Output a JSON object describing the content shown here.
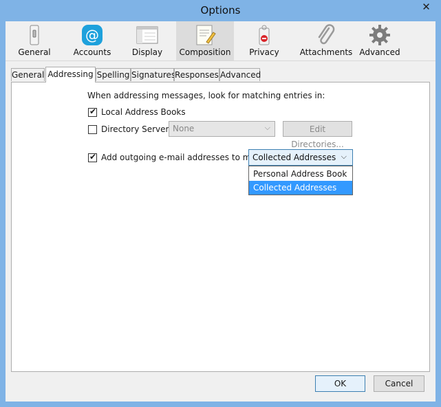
{
  "window": {
    "title": "Options",
    "close_glyph": "✕"
  },
  "toolbar": {
    "items": [
      {
        "label": "General",
        "icon": "general-switch-icon"
      },
      {
        "label": "Accounts",
        "icon": "at-sign-icon"
      },
      {
        "label": "Display",
        "icon": "display-window-icon"
      },
      {
        "label": "Composition",
        "icon": "composition-notepad-icon",
        "selected": true
      },
      {
        "label": "Privacy",
        "icon": "privacy-tag-icon"
      },
      {
        "label": "Attachments",
        "icon": "paperclip-icon"
      },
      {
        "label": "Advanced",
        "icon": "gear-icon"
      }
    ]
  },
  "subtabs": [
    "General",
    "Addressing",
    "Spelling",
    "Signatures",
    "Responses",
    "Advanced"
  ],
  "active_subtab": "Addressing",
  "addressing": {
    "intro": "When addressing messages, look for matching entries in:",
    "local_books": {
      "label": "Local Address Books",
      "checked": true
    },
    "directory_server": {
      "label": "Directory Server:",
      "checked": false,
      "value": "None",
      "edit_label": "Edit Directories..."
    },
    "outgoing": {
      "label": "Add outgoing e-mail addresses to my:",
      "checked": true,
      "value": "Collected Addresses"
    },
    "dropdown_options": [
      "Personal Address Book",
      "Collected Addresses"
    ]
  },
  "footer": {
    "ok_label": "OK",
    "cancel_label": "Cancel"
  },
  "colors": {
    "title_bar": "#7fb3e6",
    "selection": "#3399ff",
    "accounts_icon": "#1ea1dc"
  },
  "check_glyph": "✔"
}
